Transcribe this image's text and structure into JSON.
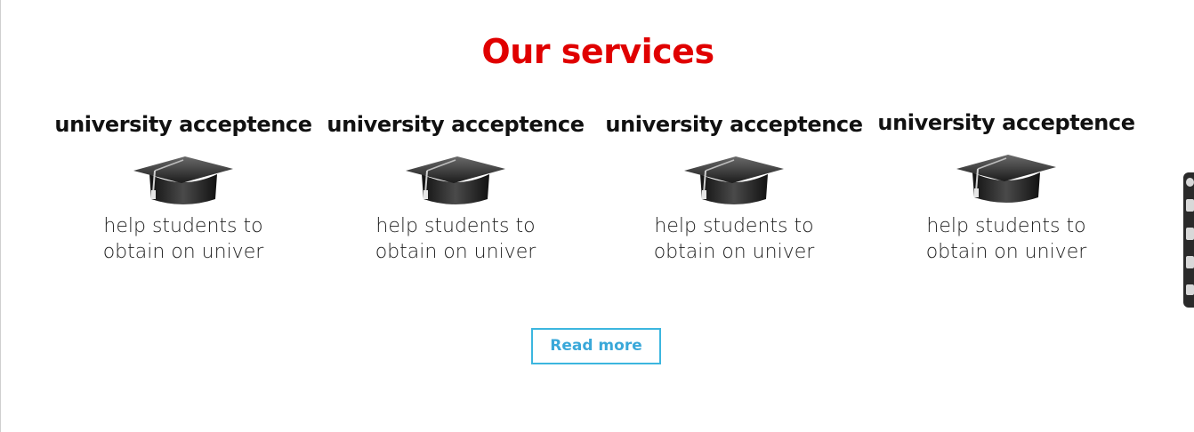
{
  "section": {
    "title": "Our services",
    "title_color": "#e00000"
  },
  "services": [
    {
      "heading": "university acceptence",
      "icon": "graduation-cap-icon",
      "description_line1": "help students to",
      "description_line2": "obtain on univer"
    },
    {
      "heading": "university acceptence",
      "icon": "graduation-cap-icon",
      "description_line1": "help students to",
      "description_line2": "obtain on univer"
    },
    {
      "heading": "university acceptence",
      "icon": "graduation-cap-icon",
      "description_line1": "help students to",
      "description_line2": "obtain on univer"
    },
    {
      "heading": "university acceptence",
      "icon": "graduation-cap-icon",
      "description_line1": "help students to",
      "description_line2": "obtain on univer"
    }
  ],
  "read_more": {
    "label": "Read more",
    "accent_color": "#3cb6df"
  },
  "side_dock": {
    "icons": [
      "gear-icon",
      "square-icon",
      "square-icon",
      "copy-icon",
      "puzzle-icon"
    ]
  }
}
